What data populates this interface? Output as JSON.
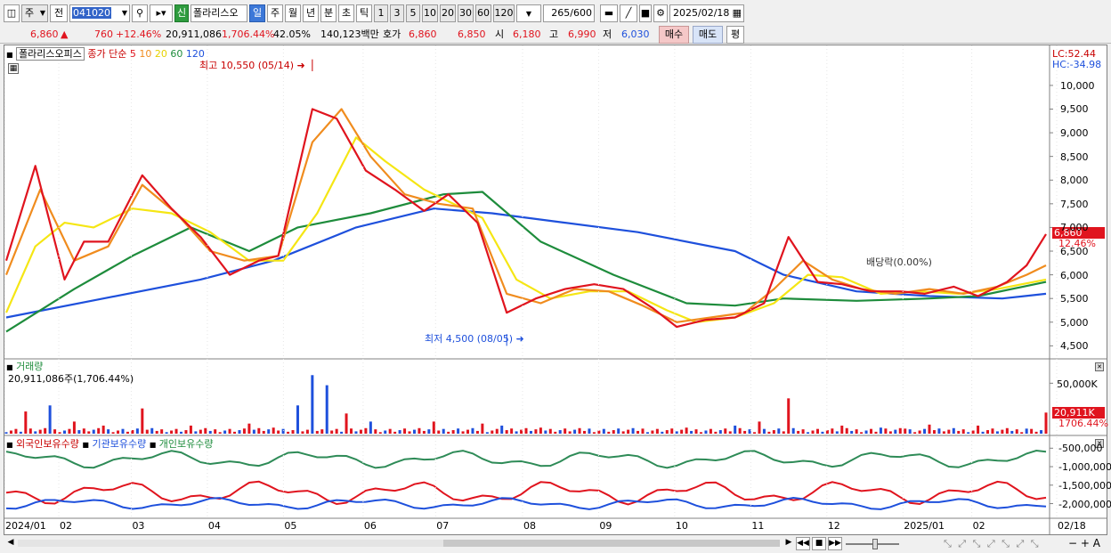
{
  "toolbar": {
    "mode": "주",
    "prev": "전",
    "code": "041020",
    "badge": "신",
    "name": "폴라리스오",
    "periods": [
      "일",
      "주",
      "월",
      "년",
      "분",
      "초",
      "틱"
    ],
    "minutes": [
      "1",
      "3",
      "5",
      "10",
      "20",
      "30",
      "60",
      "120"
    ],
    "count": "265",
    "total": "/600",
    "date": "2025/02/18"
  },
  "info": {
    "price": "6,860",
    "change": "760",
    "change_pct": "+12.46%",
    "volume": "20,911,086",
    "volume_ratio": "1,706.44%",
    "turnover": "42.05%",
    "amount": "140,123백만",
    "quote_label": "호가",
    "ask": "6,860",
    "bid": "6,850",
    "open_label": "시",
    "open": "6,180",
    "high_label": "고",
    "high": "6,990",
    "low_label": "저",
    "low": "6,030",
    "buy": "매수",
    "sell": "매도",
    "avg": "평"
  },
  "chart_data": {
    "type": "line",
    "title": "폴라리스오피스",
    "price_legend": {
      "price": "종가",
      "ma_type": "단순",
      "ma": [
        "5",
        "10",
        "20",
        "60",
        "120"
      ]
    },
    "high_annotation": "최고 10,550 (05/14)",
    "low_annotation": "최저 4,500 (08/05)",
    "dividend_annotation": "배당락(0.00%)",
    "lc": "LC:52.44",
    "hc": "HC:-34.98",
    "y_ticks": [
      "10,000",
      "9,500",
      "9,000",
      "8,500",
      "8,000",
      "7,500",
      "7,000",
      "6,500",
      "6,000",
      "5,500",
      "5,000",
      "4,500"
    ],
    "ylim": [
      4300,
      10600
    ],
    "last_price": "6,860",
    "last_pct": "12.46%",
    "x_ticks": [
      "2024/01",
      "02",
      "03",
      "04",
      "05",
      "06",
      "07",
      "08",
      "09",
      "10",
      "11",
      "12",
      "2025/01",
      "02",
      "02/18"
    ],
    "series": [
      {
        "name": "5",
        "color": "#e0141e",
        "values": [
          [
            0,
            6300
          ],
          [
            6,
            8300
          ],
          [
            12,
            5900
          ],
          [
            16,
            6700
          ],
          [
            21,
            6700
          ],
          [
            28,
            8100
          ],
          [
            34,
            7400
          ],
          [
            40,
            6800
          ],
          [
            46,
            6000
          ],
          [
            52,
            6300
          ],
          [
            56,
            6400
          ],
          [
            63,
            9500
          ],
          [
            68,
            9300
          ],
          [
            74,
            8200
          ],
          [
            80,
            7800
          ],
          [
            86,
            7350
          ],
          [
            91,
            7700
          ],
          [
            97,
            7100
          ],
          [
            103,
            5200
          ],
          [
            109,
            5500
          ],
          [
            115,
            5700
          ],
          [
            121,
            5800
          ],
          [
            127,
            5700
          ],
          [
            133,
            5300
          ],
          [
            138,
            4900
          ],
          [
            144,
            5050
          ],
          [
            150,
            5100
          ],
          [
            156,
            5400
          ],
          [
            161,
            6800
          ],
          [
            167,
            5850
          ],
          [
            172,
            5800
          ],
          [
            178,
            5650
          ],
          [
            184,
            5650
          ],
          [
            189,
            5600
          ],
          [
            195,
            5750
          ],
          [
            200,
            5550
          ],
          [
            206,
            5850
          ],
          [
            210,
            6200
          ],
          [
            214,
            6860
          ]
        ]
      },
      {
        "name": "10",
        "color": "#f08c1e",
        "values": [
          [
            0,
            6000
          ],
          [
            7,
            7800
          ],
          [
            14,
            6300
          ],
          [
            21,
            6600
          ],
          [
            28,
            7900
          ],
          [
            35,
            7300
          ],
          [
            42,
            6500
          ],
          [
            49,
            6300
          ],
          [
            56,
            6400
          ],
          [
            63,
            8800
          ],
          [
            69,
            9500
          ],
          [
            75,
            8500
          ],
          [
            82,
            7700
          ],
          [
            89,
            7500
          ],
          [
            96,
            7400
          ],
          [
            103,
            5600
          ],
          [
            110,
            5400
          ],
          [
            117,
            5700
          ],
          [
            124,
            5650
          ],
          [
            131,
            5350
          ],
          [
            138,
            5000
          ],
          [
            145,
            5100
          ],
          [
            152,
            5200
          ],
          [
            158,
            5700
          ],
          [
            164,
            6300
          ],
          [
            170,
            5900
          ],
          [
            176,
            5700
          ],
          [
            183,
            5600
          ],
          [
            190,
            5700
          ],
          [
            197,
            5600
          ],
          [
            204,
            5750
          ],
          [
            210,
            6000
          ],
          [
            214,
            6200
          ]
        ]
      },
      {
        "name": "20",
        "color": "#f5e614",
        "values": [
          [
            0,
            5200
          ],
          [
            6,
            6600
          ],
          [
            12,
            7100
          ],
          [
            18,
            7000
          ],
          [
            26,
            7400
          ],
          [
            34,
            7300
          ],
          [
            42,
            6900
          ],
          [
            50,
            6300
          ],
          [
            57,
            6300
          ],
          [
            64,
            7300
          ],
          [
            72,
            8900
          ],
          [
            78,
            8400
          ],
          [
            86,
            7800
          ],
          [
            92,
            7500
          ],
          [
            98,
            7200
          ],
          [
            105,
            5900
          ],
          [
            112,
            5500
          ],
          [
            120,
            5650
          ],
          [
            128,
            5650
          ],
          [
            136,
            5250
          ],
          [
            142,
            5000
          ],
          [
            150,
            5100
          ],
          [
            158,
            5400
          ],
          [
            165,
            6000
          ],
          [
            172,
            5950
          ],
          [
            180,
            5600
          ],
          [
            188,
            5650
          ],
          [
            196,
            5600
          ],
          [
            204,
            5700
          ],
          [
            214,
            5900
          ]
        ]
      },
      {
        "name": "60",
        "color": "#1e8c3c",
        "values": [
          [
            0,
            4800
          ],
          [
            14,
            5700
          ],
          [
            26,
            6400
          ],
          [
            38,
            7000
          ],
          [
            50,
            6500
          ],
          [
            60,
            7000
          ],
          [
            75,
            7300
          ],
          [
            90,
            7700
          ],
          [
            98,
            7750
          ],
          [
            110,
            6700
          ],
          [
            125,
            6000
          ],
          [
            140,
            5400
          ],
          [
            150,
            5350
          ],
          [
            160,
            5500
          ],
          [
            175,
            5450
          ],
          [
            190,
            5500
          ],
          [
            200,
            5550
          ],
          [
            214,
            5850
          ]
        ]
      },
      {
        "name": "120",
        "color": "#1e50dc",
        "values": [
          [
            0,
            5100
          ],
          [
            20,
            5500
          ],
          [
            40,
            5900
          ],
          [
            55,
            6300
          ],
          [
            72,
            7000
          ],
          [
            88,
            7400
          ],
          [
            100,
            7300
          ],
          [
            115,
            7100
          ],
          [
            130,
            6900
          ],
          [
            150,
            6500
          ],
          [
            160,
            6000
          ],
          [
            175,
            5650
          ],
          [
            190,
            5550
          ],
          [
            205,
            5500
          ],
          [
            214,
            5600
          ]
        ]
      }
    ],
    "volume_label": "거래량",
    "volume_value": "20,911,086주(1,706.44%)",
    "volume_ticks": [
      "50,000K"
    ],
    "volume_last": "20,911K",
    "volume_last_pct": "1706.44%",
    "volume_ylim": [
      0,
      60000
    ],
    "volume_spikes": [
      [
        4,
        22000
      ],
      [
        9,
        28000
      ],
      [
        14,
        12000
      ],
      [
        20,
        8000
      ],
      [
        28,
        25000
      ],
      [
        38,
        8000
      ],
      [
        50,
        10000
      ],
      [
        55,
        6000
      ],
      [
        60,
        28000
      ],
      [
        63,
        58000
      ],
      [
        66,
        48000
      ],
      [
        70,
        20000
      ],
      [
        75,
        12000
      ],
      [
        88,
        12000
      ],
      [
        98,
        10000
      ],
      [
        102,
        8000
      ],
      [
        110,
        6000
      ],
      [
        120,
        5000
      ],
      [
        131,
        5000
      ],
      [
        140,
        6000
      ],
      [
        150,
        8000
      ],
      [
        155,
        12000
      ],
      [
        161,
        35000
      ],
      [
        172,
        8000
      ],
      [
        180,
        6000
      ],
      [
        185,
        5000
      ],
      [
        190,
        9000
      ],
      [
        200,
        8000
      ],
      [
        210,
        5000
      ],
      [
        214,
        20911
      ]
    ],
    "ownership_legend": [
      "외국인보유수량",
      "기관보유수량",
      "개인보유수량"
    ],
    "ownership_ticks": [
      "-500,000",
      "-1,000,000",
      "-1,500,000",
      "-2,000,000"
    ],
    "ownership_ylim": [
      -2300000,
      -300000
    ]
  }
}
